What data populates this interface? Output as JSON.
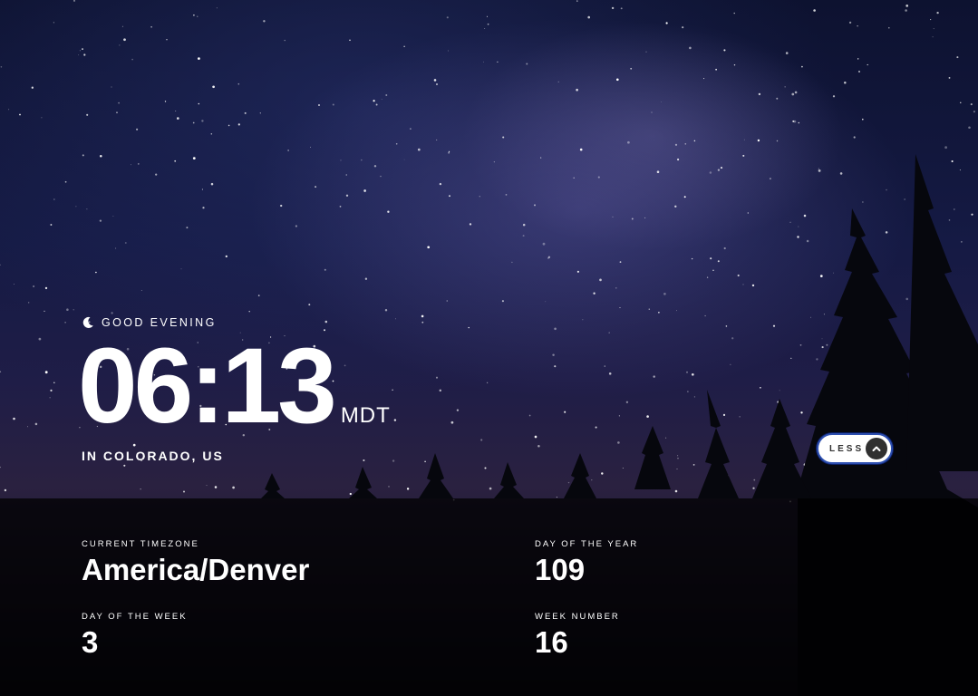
{
  "greeting": {
    "icon": "moon-icon",
    "text": "GOOD EVENING"
  },
  "clock": {
    "time": "06:13",
    "abbreviation": "MDT",
    "location": "IN COLORADO, US"
  },
  "toggle": {
    "label": "LESS",
    "icon": "chevron-up-icon"
  },
  "details": {
    "timezone_label": "CURRENT TIMEZONE",
    "timezone_value": "America/Denver",
    "day_of_year_label": "DAY OF THE YEAR",
    "day_of_year_value": "109",
    "day_of_week_label": "DAY OF THE WEEK",
    "day_of_week_value": "3",
    "week_number_label": "WEEK NUMBER",
    "week_number_value": "16"
  },
  "colors": {
    "text": "#ffffff",
    "button_bg": "#ffffff",
    "button_text": "#303030",
    "button_border": "#2d4fb0",
    "panel_overlay": "#000000"
  }
}
